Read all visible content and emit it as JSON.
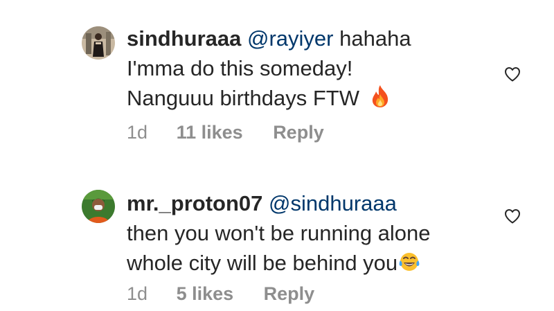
{
  "comments": [
    {
      "username": "sindhuraaa",
      "mention": "@rayiyer",
      "lines": [
        "hahaha",
        "I'mma do this someday!",
        "Nanguuu birthdays FTW"
      ],
      "emoji": "fire-emoji",
      "time": "1d",
      "likes": "11 likes",
      "reply": "Reply"
    },
    {
      "username": "mr._proton07",
      "mention": "@sindhuraaa",
      "lines": [
        "then you won't be running alone",
        "whole city will be behind you"
      ],
      "emoji": "tears-of-joy-emoji",
      "time": "1d",
      "likes": "5 likes",
      "reply": "Reply"
    }
  ],
  "colors": {
    "text": "#262626",
    "mention": "#00376b",
    "meta": "#8e8e8e"
  }
}
